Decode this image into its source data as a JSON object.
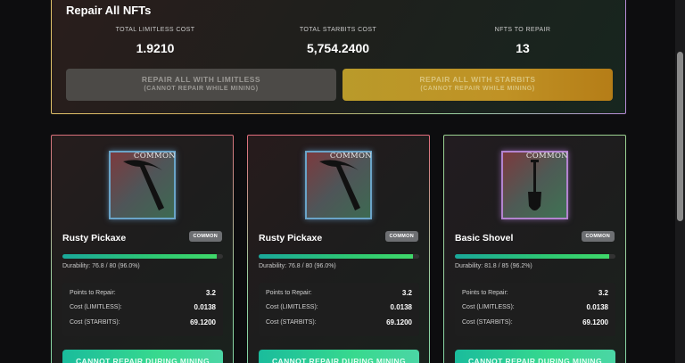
{
  "repair_all": {
    "title": "Repair All NFTs",
    "stats": [
      {
        "label": "TOTAL LIMITLESS COST",
        "value": "1.9210"
      },
      {
        "label": "TOTAL STARBITS COST",
        "value": "5,754.2400"
      },
      {
        "label": "NFTS TO REPAIR",
        "value": "13"
      }
    ],
    "buttons": {
      "limitless": {
        "line1": "REPAIR ALL WITH LIMITLESS",
        "line2": "(CANNOT REPAIR WHILE MINING)"
      },
      "starbits": {
        "line1": "REPAIR ALL WITH STARBITS",
        "line2": "(CANNOT REPAIR WHILE MINING)"
      }
    }
  },
  "cards": [
    {
      "image_rarity": "COMMON",
      "icon": "pickaxe-icon",
      "name": "Rusty Pickaxe",
      "badge": "COMMON",
      "durability_fraction": 0.96,
      "durability_text": "Durability: 76.8 / 80 (96.0%)",
      "rows": [
        {
          "label": "Points to Repair:",
          "value": "3.2"
        },
        {
          "label": "Cost (LIMITLESS):",
          "value": "0.0138"
        },
        {
          "label": "Cost (STARBITS):",
          "value": "69.1200"
        }
      ],
      "button": "CANNOT REPAIR DURING MINING"
    },
    {
      "image_rarity": "COMMON",
      "icon": "pickaxe-icon",
      "name": "Rusty Pickaxe",
      "badge": "COMMON",
      "durability_fraction": 0.96,
      "durability_text": "Durability: 76.8 / 80 (96.0%)",
      "rows": [
        {
          "label": "Points to Repair:",
          "value": "3.2"
        },
        {
          "label": "Cost (LIMITLESS):",
          "value": "0.0138"
        },
        {
          "label": "Cost (STARBITS):",
          "value": "69.1200"
        }
      ],
      "button": "CANNOT REPAIR DURING MINING"
    },
    {
      "image_rarity": "COMMON",
      "icon": "shovel-icon",
      "name": "Basic Shovel",
      "badge": "COMMON",
      "durability_fraction": 0.962,
      "durability_text": "Durability: 81.8 / 85 (96.2%)",
      "rows": [
        {
          "label": "Points to Repair:",
          "value": "3.2"
        },
        {
          "label": "Cost (LIMITLESS):",
          "value": "0.0138"
        },
        {
          "label": "Cost (STARBITS):",
          "value": "69.1200"
        }
      ],
      "button": "CANNOT REPAIR DURING MINING"
    }
  ]
}
